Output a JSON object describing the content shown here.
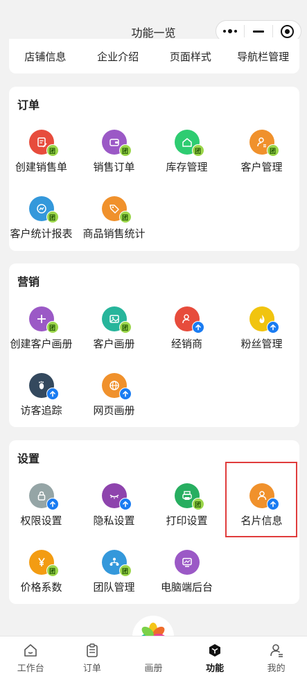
{
  "header": {
    "title": "功能一览"
  },
  "top_row": [
    "店铺信息",
    "企业介绍",
    "页面样式",
    "导航栏管理"
  ],
  "sections": [
    {
      "title": "订单",
      "items": [
        {
          "label": "创建销售单",
          "color": "#e74c3c",
          "icon": "edit-doc-icon",
          "badge": "团"
        },
        {
          "label": "销售订单",
          "color": "#9b59c6",
          "icon": "wallet-icon",
          "badge": "团"
        },
        {
          "label": "库存管理",
          "color": "#2ecc71",
          "icon": "warehouse-icon",
          "badge": "团"
        },
        {
          "label": "客户管理",
          "color": "#f0912c",
          "icon": "customer-icon",
          "badge": "团"
        },
        {
          "label": "客户统计报表",
          "color": "#3498db",
          "icon": "chart-icon",
          "badge": "团"
        },
        {
          "label": "商品销售统计",
          "color": "#f0912c",
          "icon": "tag-icon",
          "badge": "团"
        }
      ]
    },
    {
      "title": "营销",
      "items": [
        {
          "label": "创建客户画册",
          "color": "#9b59c6",
          "icon": "plus-icon",
          "badge": "团"
        },
        {
          "label": "客户画册",
          "color": "#27b59b",
          "icon": "image-icon",
          "badge": "团"
        },
        {
          "label": "经销商",
          "color": "#e74c3c",
          "icon": "dealer-icon",
          "badge": "up"
        },
        {
          "label": "粉丝管理",
          "color": "#f1c40f",
          "icon": "flame-icon",
          "badge": "up"
        },
        {
          "label": "访客追踪",
          "color": "#34495e",
          "icon": "footprint-icon",
          "badge": "up"
        },
        {
          "label": "网页画册",
          "color": "#f0912c",
          "icon": "globe-icon",
          "badge": "up"
        }
      ]
    },
    {
      "title": "设置",
      "items": [
        {
          "label": "权限设置",
          "color": "#95a5a6",
          "icon": "lock-icon",
          "badge": "up"
        },
        {
          "label": "隐私设置",
          "color": "#8e44ad",
          "icon": "eye-closed-icon",
          "badge": "up"
        },
        {
          "label": "打印设置",
          "color": "#27ae60",
          "icon": "printer-icon",
          "badge": "团"
        },
        {
          "label": "名片信息",
          "color": "#f0912c",
          "icon": "person-icon",
          "badge": "up"
        },
        {
          "label": "价格系数",
          "color": "#f39c12",
          "icon": "yen-icon",
          "badge": "团"
        },
        {
          "label": "团队管理",
          "color": "#3498db",
          "icon": "team-icon",
          "badge": "团"
        },
        {
          "label": "电脑端后台",
          "color": "#9b59c6",
          "icon": "monitor-icon",
          "badge": ""
        }
      ]
    }
  ],
  "tabbar": [
    {
      "label": "工作台",
      "icon": "home-icon"
    },
    {
      "label": "订单",
      "icon": "clipboard-icon"
    },
    {
      "label": "画册",
      "icon": "pinwheel-icon"
    },
    {
      "label": "功能",
      "icon": "cube-icon",
      "active": true
    },
    {
      "label": "我的",
      "icon": "user-icon"
    }
  ]
}
